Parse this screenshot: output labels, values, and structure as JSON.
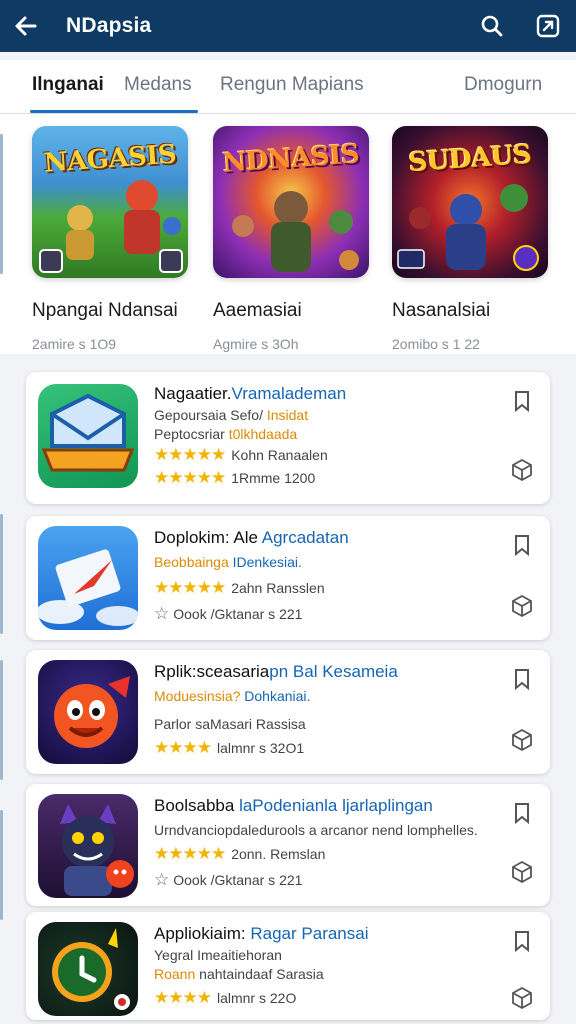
{
  "appbar": {
    "title": "NDapsia",
    "back_icon": "arrow-left-icon",
    "search_icon": "search-icon",
    "share_icon": "open-external-icon"
  },
  "tabs": [
    {
      "label": "Ilnganai",
      "active": true
    },
    {
      "label": "Medans",
      "active": false
    },
    {
      "label": "Rengun Mapians",
      "active": false
    },
    {
      "label": "Dmogurn",
      "active": false
    }
  ],
  "featured": [
    {
      "banner": "NAGASIS",
      "name": "Npangai Ndansai",
      "sub": "2amire s 1O9"
    },
    {
      "banner": "NDNASIS",
      "name": "Aaemasiai",
      "sub": "Agmire s 3Oh"
    },
    {
      "banner": "SUDAUS",
      "name": "Nasanalsiai",
      "sub": "2omibo s 1 22"
    }
  ],
  "apps": [
    {
      "title": "Nagaatier.",
      "title_hl": "Vramalademan",
      "lines": [
        {
          "text": "Gepoursaia Sefo/ ",
          "hl": "Insidat",
          "style": "plain"
        },
        {
          "text": "Peptocsriar ",
          "hl": "t0lkhdaada",
          "style": "plain"
        },
        {
          "stars": "★★★★★",
          "text": "Kohn Ranaalen",
          "style": "stars"
        },
        {
          "stars": "★★★★★",
          "text": "1Rmme 1200",
          "style": "stars"
        }
      ]
    },
    {
      "title": "Doplokim: Ale ",
      "title_hl": "Agrcadatan",
      "lines": [
        {
          "text": "Beobbainga ",
          "hl": "IDenkesiai.",
          "style": "orange"
        },
        {
          "stars": "★★★★★",
          "text": "2ahn Ransslen",
          "style": "stars"
        },
        {
          "ostar": "☆",
          "text": "Oook /Gktanar s 221",
          "style": "ostar"
        }
      ]
    },
    {
      "title": "Rplik:sceasaria",
      "title_hl": "pn Bal Kesameia",
      "lines": [
        {
          "text": "Moduesinsia? ",
          "hl": "Dohkaniai.",
          "style": "orange"
        },
        {
          "text": "Parlor saMasari Rassisa",
          "style": "plain"
        },
        {
          "stars": "★★★★",
          "text": "lalmnr s 32O1",
          "style": "stars"
        }
      ]
    },
    {
      "title": "Boolsabba ",
      "title_hl": "laPodenianla ljarlaplingan",
      "lines": [
        {
          "text": "Urndvanciopdaledurools a arcanor nend lomphelles.",
          "style": "plain"
        },
        {
          "stars": "★★★★★",
          "text": "2onn. Remslan",
          "style": "stars"
        },
        {
          "ostar": "☆",
          "text": "Oook /Gktanar s 221",
          "style": "ostar"
        }
      ]
    },
    {
      "title": "Appliokiaim: ",
      "title_hl": "Ragar Paransai",
      "lines": [
        {
          "text": "Yegral Imeaitiehoran",
          "style": "plain"
        },
        {
          "text": "Roann ",
          "hl": "nahtaindaaf Sarasia",
          "style": "orange"
        },
        {
          "stars": "★★★★",
          "text": "lalmnr s 22O",
          "style": "stars"
        }
      ]
    }
  ],
  "colors": {
    "appbar": "#0f3a63",
    "accent": "#1e6fc1",
    "star": "#f3b400"
  }
}
